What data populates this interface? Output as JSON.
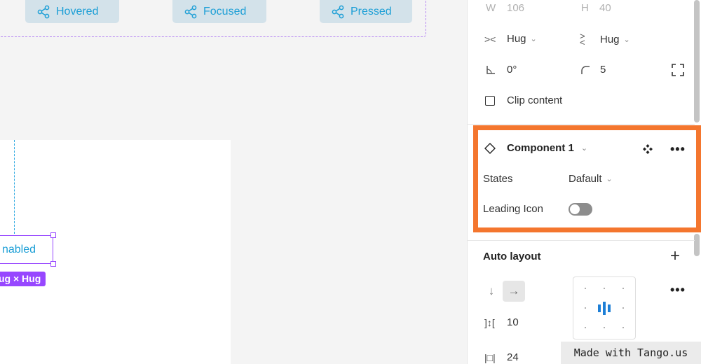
{
  "canvas": {
    "states": [
      "Hovered",
      "Focused",
      "Pressed"
    ],
    "selected_label": "nabled",
    "size_badge": "ug × Hug"
  },
  "panel": {
    "w_label": "W",
    "w_value": "106",
    "h_label": "H",
    "h_value": "40",
    "horizontal_resizing": "Hug",
    "vertical_resizing": "Hug",
    "rotation": "0°",
    "corner_radius": "5",
    "clip_content": "Clip content",
    "component": {
      "name": "Component 1",
      "props": [
        {
          "name": "States",
          "value": "Dafault"
        },
        {
          "name": "Leading Icon",
          "value": "off"
        }
      ]
    },
    "auto_layout": {
      "title": "Auto layout",
      "spacing": "10",
      "padding": "24"
    }
  },
  "colors": {
    "highlight": "#f4762e",
    "selection": "#9747ff",
    "accent": "#1d9fd6"
  },
  "watermark": "Made with Tango.us"
}
